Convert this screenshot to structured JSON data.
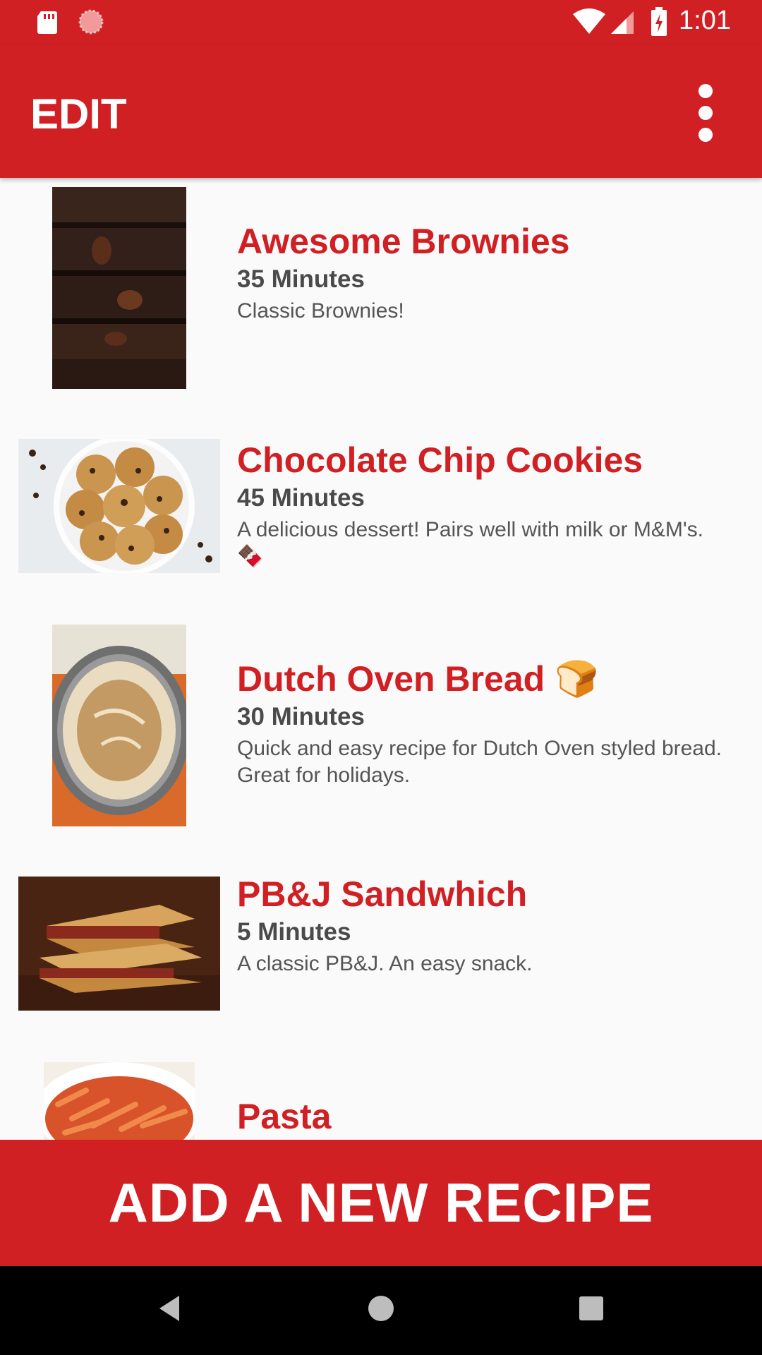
{
  "status_bar": {
    "time": "1:01",
    "icons": [
      "sd-card-icon",
      "spinner-icon",
      "wifi-icon",
      "signal-icon",
      "battery-charging-icon"
    ]
  },
  "app_bar": {
    "title": "EDIT",
    "menu_icon": "more-vertical-icon"
  },
  "recipes": [
    {
      "title": "Awesome Brownies",
      "time": "35 Minutes",
      "description": "Classic Brownies!",
      "image": "brownies-photo"
    },
    {
      "title": "Chocolate Chip Cookies",
      "time": "45 Minutes",
      "description": "A delicious dessert! Pairs well with milk or M&M's. 🍫",
      "image": "cookies-photo"
    },
    {
      "title": "Dutch Oven Bread 🍞",
      "time": "30 Minutes",
      "description": "Quick and easy recipe for Dutch Oven styled bread. Great for holidays.",
      "image": "bread-photo"
    },
    {
      "title": "PB&J Sandwhich",
      "time": "5 Minutes",
      "description": "A classic PB&J. An easy snack.",
      "image": "sandwich-photo"
    },
    {
      "title": "Pasta",
      "image": "pasta-photo"
    }
  ],
  "add_button": {
    "label": "ADD A NEW RECIPE"
  },
  "nav_bar": {
    "icons": [
      "back-icon",
      "home-icon",
      "recents-icon"
    ]
  },
  "colors": {
    "primary": "#d12024",
    "background": "#fafafa",
    "title_text": "#d12024",
    "time_text": "#4a4a4a",
    "description_text": "#555555"
  }
}
